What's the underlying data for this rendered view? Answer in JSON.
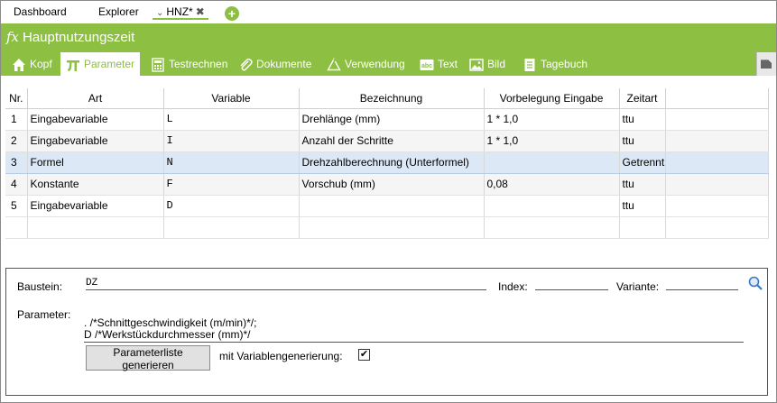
{
  "tabs": {
    "dashboard": "Dashboard",
    "explorer": "Explorer",
    "active": "HNZ*"
  },
  "header": {
    "fx_symbol": "fx",
    "title": "Hauptnutzungszeit"
  },
  "nav": {
    "items": [
      {
        "label": "Kopf",
        "icon": "home-icon"
      },
      {
        "label": "Parameter",
        "icon": "pi-icon"
      },
      {
        "label": "Testrechnen",
        "icon": "calculator-icon"
      },
      {
        "label": "Dokumente",
        "icon": "paperclip-icon"
      },
      {
        "label": "Verwendung",
        "icon": "recycle-icon"
      },
      {
        "label": "Text",
        "icon": "text-abc-icon"
      },
      {
        "label": "Bild",
        "icon": "image-icon"
      },
      {
        "label": "Tagebuch",
        "icon": "notebook-icon"
      }
    ],
    "active_index": 1
  },
  "table": {
    "headers": [
      "Nr.",
      "Art",
      "Variable",
      "Bezeichnung",
      "Vorbelegung Eingabe",
      "Zeitart"
    ],
    "rows": [
      {
        "nr": "1",
        "art": "Eingabevariable",
        "variable": "L",
        "bezeichnung": "Drehlänge (mm)",
        "vorbelegung": "1 * 1,0",
        "zeitart": "ttu"
      },
      {
        "nr": "2",
        "art": "Eingabevariable",
        "variable": "I",
        "bezeichnung": "Anzahl der Schritte",
        "vorbelegung": "1 * 1,0",
        "zeitart": "ttu"
      },
      {
        "nr": "3",
        "art": "Formel",
        "variable": "N",
        "bezeichnung": "Drehzahlberechnung (Unterformel)",
        "vorbelegung": "",
        "zeitart": "Getrennt"
      },
      {
        "nr": "4",
        "art": "Konstante",
        "variable": "F",
        "bezeichnung": "Vorschub (mm)",
        "vorbelegung": "0,08",
        "zeitart": "ttu"
      },
      {
        "nr": "5",
        "art": "Eingabevariable",
        "variable": "D",
        "bezeichnung": "",
        "vorbelegung": "",
        "zeitart": "ttu"
      }
    ],
    "selected_row": 3
  },
  "panel": {
    "baustein_label": "Baustein:",
    "baustein_value": "DZ",
    "index_label": "Index:",
    "index_value": "",
    "variante_label": "Variante:",
    "variante_value": "",
    "parameter_label": "Parameter:",
    "parameter_line1": ". /*Schnittgeschwindigkeit (m/min)*/;",
    "parameter_line2": "D /*Werkstückdurchmesser (mm)*/",
    "generate_button": "Parameterliste generieren",
    "checkbox_label": "mit Variablengenerierung:",
    "checkbox_checked": true
  },
  "colors": {
    "accent": "#8dbf43",
    "selected_row": "#dce8f6"
  }
}
